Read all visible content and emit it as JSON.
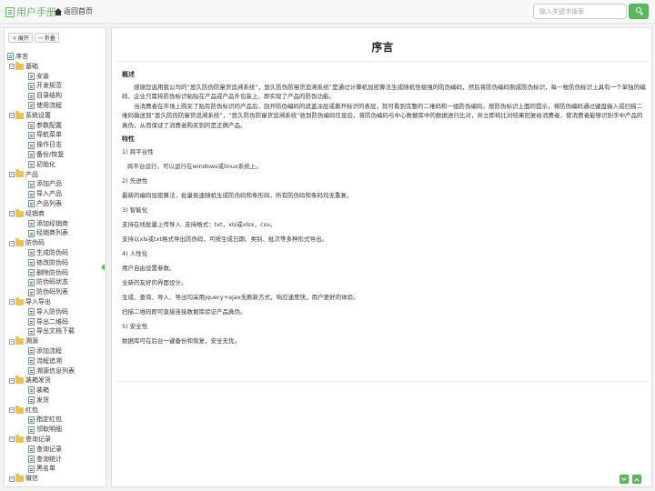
{
  "header": {
    "brand": "用户手册",
    "home_link": "返回首页",
    "search_placeholder": "输入关键字搜索",
    "search_icon": "search-icon"
  },
  "sidebar": {
    "expand_label": "展开",
    "collapse_label": "折叠",
    "tree": [
      {
        "label": "序言",
        "level": 0,
        "type": "page"
      },
      {
        "label": "基础",
        "level": 1,
        "type": "folder"
      },
      {
        "label": "安装",
        "level": 2,
        "type": "page"
      },
      {
        "label": "开发规范",
        "level": 2,
        "type": "page"
      },
      {
        "label": "目录结构",
        "level": 2,
        "type": "page"
      },
      {
        "label": "使用流程",
        "level": 2,
        "type": "page"
      },
      {
        "label": "系统设置",
        "level": 1,
        "type": "folder"
      },
      {
        "label": "参数配置",
        "level": 2,
        "type": "page"
      },
      {
        "label": "导航菜单",
        "level": 2,
        "type": "page"
      },
      {
        "label": "操作日志",
        "level": 2,
        "type": "page"
      },
      {
        "label": "备份/恢复",
        "level": 2,
        "type": "page"
      },
      {
        "label": "初始化",
        "level": 2,
        "type": "page"
      },
      {
        "label": "产品",
        "level": 1,
        "type": "folder"
      },
      {
        "label": "添加产品",
        "level": 2,
        "type": "page"
      },
      {
        "label": "导入产品",
        "level": 2,
        "type": "page"
      },
      {
        "label": "产品列表",
        "level": 2,
        "type": "page"
      },
      {
        "label": "经销商",
        "level": 1,
        "type": "folder"
      },
      {
        "label": "添加经销商",
        "level": 2,
        "type": "page"
      },
      {
        "label": "经销商列表",
        "level": 2,
        "type": "page"
      },
      {
        "label": "防伪码",
        "level": 1,
        "type": "folder"
      },
      {
        "label": "生成防伪码",
        "level": 2,
        "type": "page"
      },
      {
        "label": "修改防伪码",
        "level": 2,
        "type": "page"
      },
      {
        "label": "删除防伪码",
        "level": 2,
        "type": "page"
      },
      {
        "label": "防伪码状态",
        "level": 2,
        "type": "page"
      },
      {
        "label": "防伪码列表",
        "level": 2,
        "type": "page"
      },
      {
        "label": "导入导出",
        "level": 1,
        "type": "folder"
      },
      {
        "label": "导入防伪码",
        "level": 2,
        "type": "page"
      },
      {
        "label": "导出二维码",
        "level": 2,
        "type": "page"
      },
      {
        "label": "导出文档下载",
        "level": 2,
        "type": "page"
      },
      {
        "label": "溯源",
        "level": 1,
        "type": "folder"
      },
      {
        "label": "添加流程",
        "level": 2,
        "type": "page"
      },
      {
        "label": "流程追溯",
        "level": 2,
        "type": "page"
      },
      {
        "label": "溯源信息列表",
        "level": 2,
        "type": "page"
      },
      {
        "label": "装箱发货",
        "level": 1,
        "type": "folder"
      },
      {
        "label": "装箱",
        "level": 2,
        "type": "page"
      },
      {
        "label": "发货",
        "level": 2,
        "type": "page"
      },
      {
        "label": "红包",
        "level": 1,
        "type": "folder"
      },
      {
        "label": "指定红包",
        "level": 2,
        "type": "page"
      },
      {
        "label": "领取明细",
        "level": 2,
        "type": "page"
      },
      {
        "label": "查询记录",
        "level": 1,
        "type": "folder"
      },
      {
        "label": "查询记录",
        "level": 2,
        "type": "page"
      },
      {
        "label": "查询统计",
        "level": 2,
        "type": "page"
      },
      {
        "label": "黑名单",
        "level": 2,
        "type": "page"
      },
      {
        "label": "微信",
        "level": 1,
        "type": "folder"
      }
    ]
  },
  "content": {
    "title": "序言",
    "overview_heading": "概述",
    "overview_p1": "感谢您选用我公司的“悠久防伪防窜货追溯系统”，悠久防伪防窜货追溯系统”是通过计算机加密算法生成随机性极强的防伪编码，然后将防伪编码制成防伪标识，每一枚防伪标识上具有一个单独的编码，企业只需将防伪标识粘贴在产品或产品外包装上，即实现了产品的防伪功能。",
    "overview_p2": "当消费者在市场上购买了贴有防伪标识的产品后，刮开防伪编码的遮盖涂层或撕开标识的表层，就可看到完整的二维码和一组防伪编码。按防伪标识上面的提示，将防伪编码通过键盘输入或扫描二维码输送到“悠久防伪防窜货追溯系统”，“悠久防伪防窜货追溯系统”收到防伪编码信息后，将防伪编码与中心数据库中的数据进行比对，并立即将比对结果回复给消费者，使消费者能够识别手中产品的真伪，从而保证了消费者购买到的是正牌产品。",
    "features_heading": "特性",
    "features": [
      "1) 跨平台性",
      "跨平台运行，可以运行在windows或linux系统上。",
      "2) 先进性",
      "最新的编码加密算法，批量极速随机生成防伪码和条形码，所有防伪码和条码均无重复。",
      "3) 智能化",
      "支持在线批量上传导入. 支持格式：txt，xls或xlsx，csv。",
      "支持以xls或txt格式导出防伪码，可按生成日期、类别、批次等多种形式导出。",
      "4) 人性化",
      "用户自由设置参数。",
      "全新的友好的界面设计。",
      "生成、查询、导入、导出均采用jquery+ajax无刷新方式，响应速度快，用户更好的体验。",
      "扫描二维码即可直接连接数据库验证产品真伪。",
      "5) 安全性",
      "数据库可在后台一键备份和恢复，安全无忧。"
    ]
  },
  "colors": {
    "accent": "#5cb85c",
    "folder": "#f0c24a"
  }
}
